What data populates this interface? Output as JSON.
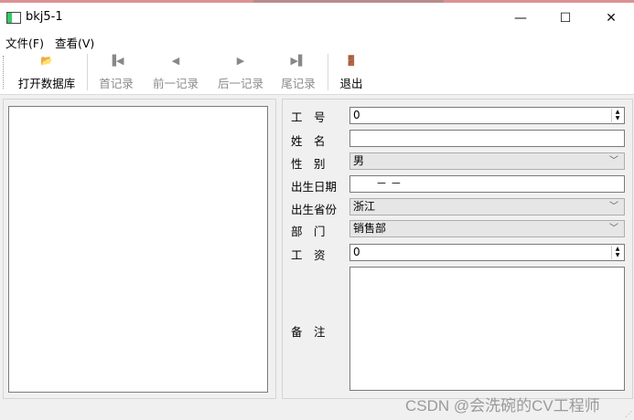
{
  "window": {
    "title": "bkj5-1",
    "minimize": "—",
    "maximize": "☐",
    "close": "✕"
  },
  "menu": {
    "file": "文件(F)",
    "view": "查看(V)"
  },
  "toolbar": {
    "open": {
      "icon": "📂",
      "label": "打开数据库"
    },
    "first": {
      "icon": "▐◀",
      "label": "首记录"
    },
    "prev": {
      "icon": "◀",
      "label": "前一记录"
    },
    "next": {
      "icon": "▶",
      "label": "后一记录"
    },
    "last": {
      "icon": "▶▌",
      "label": "尾记录"
    },
    "exit": {
      "icon": "🚪",
      "label": "退出"
    }
  },
  "form": {
    "emp_no": {
      "label": "工　号",
      "value": "0"
    },
    "name": {
      "label": "姓　名",
      "value": ""
    },
    "gender": {
      "label": "性　别",
      "value": "男"
    },
    "birth": {
      "label": "出生日期",
      "value": "－ －"
    },
    "province": {
      "label": "出生省份",
      "value": "浙江"
    },
    "dept": {
      "label": "部　门",
      "value": "销售部"
    },
    "salary": {
      "label": "工　资",
      "value": "0"
    },
    "memo": {
      "label": "备　注",
      "value": ""
    }
  },
  "watermark": "CSDN @会洗碗的CV工程师"
}
